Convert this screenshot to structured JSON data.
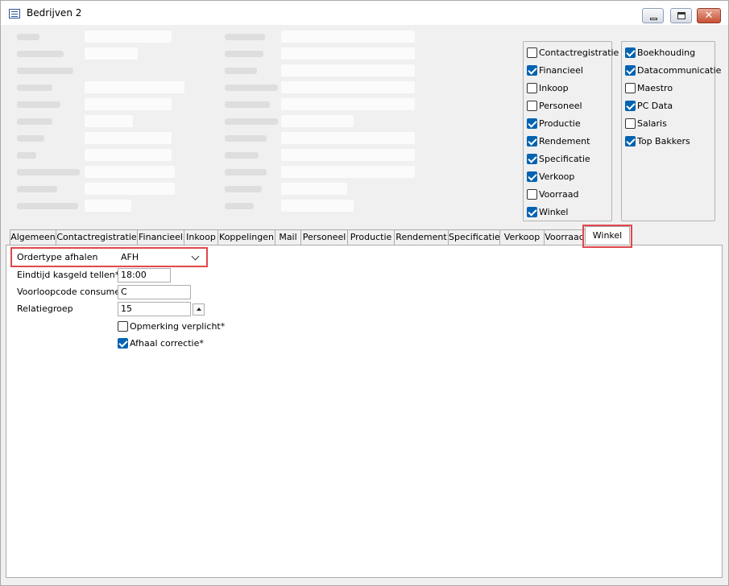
{
  "window": {
    "title": "Bedrijven 2",
    "icon": "list-window-icon"
  },
  "controls": {
    "minimize_icon": "minimize-icon",
    "maximize_icon": "maximize-icon",
    "close_icon": "close-icon"
  },
  "modules_left": [
    {
      "label": "Contactregistratie",
      "checked": false
    },
    {
      "label": "Financieel",
      "checked": true
    },
    {
      "label": "Inkoop",
      "checked": false
    },
    {
      "label": "Personeel",
      "checked": false
    },
    {
      "label": "Productie",
      "checked": true
    },
    {
      "label": "Rendement",
      "checked": true
    },
    {
      "label": "Specificatie",
      "checked": true
    },
    {
      "label": "Verkoop",
      "checked": true
    },
    {
      "label": "Voorraad",
      "checked": false
    },
    {
      "label": "Winkel",
      "checked": true
    }
  ],
  "modules_right": [
    {
      "label": "Boekhouding",
      "checked": true
    },
    {
      "label": "Datacommunicatie",
      "checked": true
    },
    {
      "label": "Maestro",
      "checked": false
    },
    {
      "label": "PC Data",
      "checked": true
    },
    {
      "label": "Salaris",
      "checked": false
    },
    {
      "label": "Top Bakkers",
      "checked": true
    }
  ],
  "tabs": [
    "Algemeen",
    "Contactregistratie",
    "Financieel",
    "Inkoop",
    "Koppelingen",
    "Mail",
    "Personeel",
    "Productie",
    "Rendement",
    "Specificatie",
    "Verkoop",
    "Voorraad",
    "Winkel"
  ],
  "active_tab": "Winkel",
  "winkel": {
    "ordertype_label": "Ordertype afhalen",
    "ordertype_value": "AFH",
    "eindtijd_label": "Eindtijd kasgeld tellen*",
    "eindtijd_value": "18:00",
    "voorloopcode_label": "Voorloopcode consument",
    "voorloopcode_value": "C",
    "relatiegroep_label": "Relatiegroep",
    "relatiegroep_value": "15",
    "opmerking_label": "Opmerking verplicht*",
    "opmerking_checked": false,
    "afhaal_label": "Afhaal correctie*",
    "afhaal_checked": true
  },
  "highlight_color": "#e0474c",
  "checkbox_accent": "#0063b1"
}
